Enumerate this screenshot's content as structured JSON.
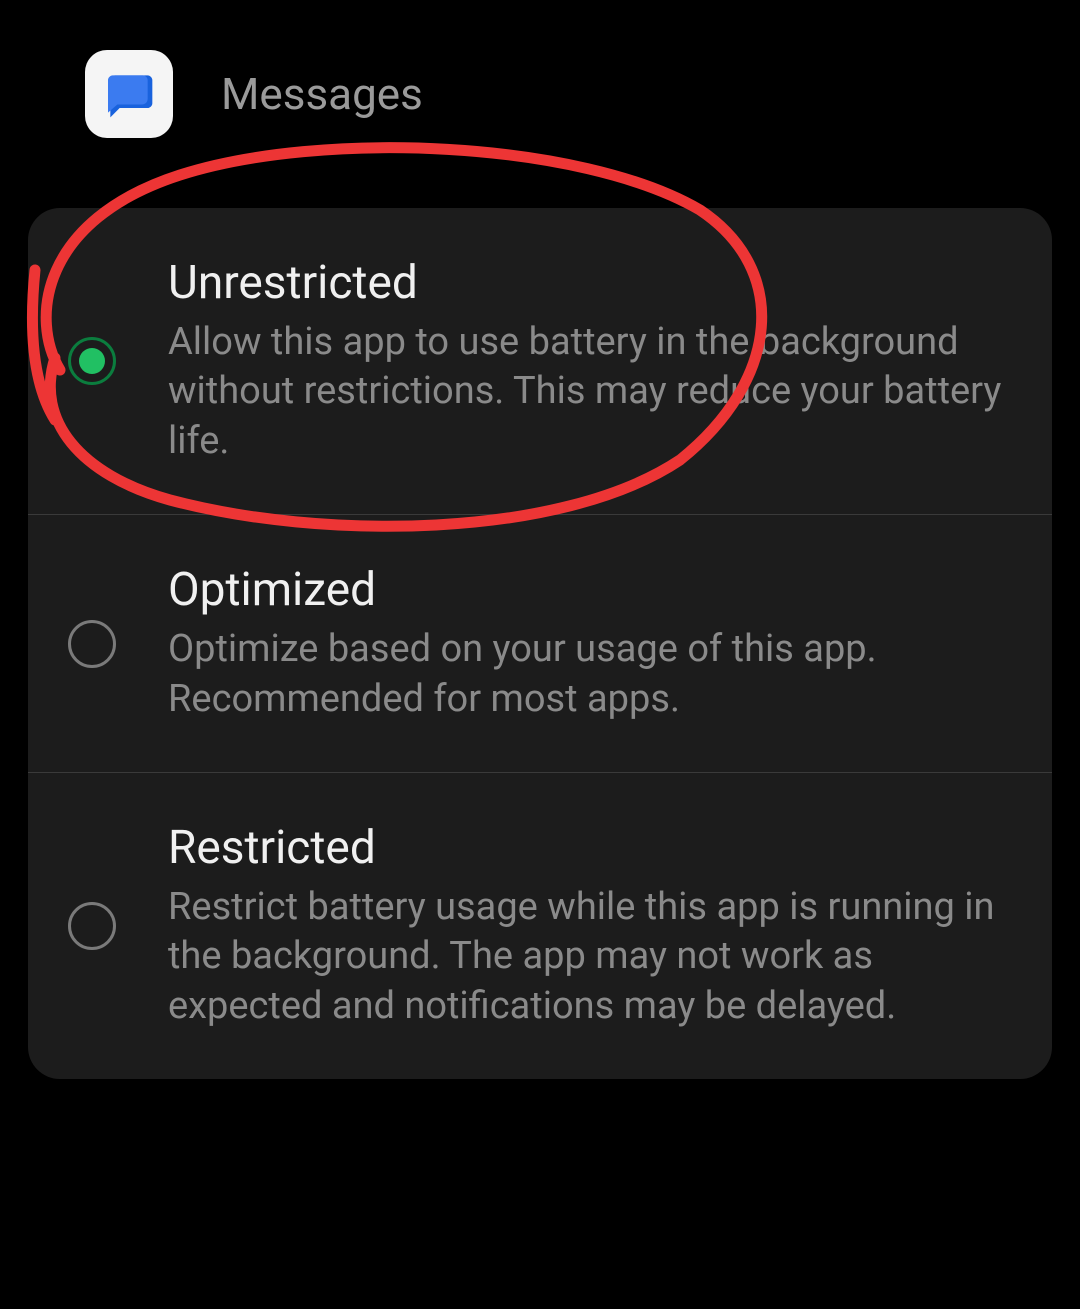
{
  "header": {
    "app_name": "Messages"
  },
  "options": [
    {
      "title": "Unrestricted",
      "description": "Allow this app to use battery in the background without restrictions. This may reduce your battery life.",
      "selected": true
    },
    {
      "title": "Optimized",
      "description": "Optimize based on your usage of this app. Recommended for most apps.",
      "selected": false
    },
    {
      "title": "Restricted",
      "description": "Restrict battery usage while this app is running in the background. The app may not work as expected and notifications may be delayed.",
      "selected": false
    }
  ],
  "annotation": {
    "color": "#ed3535"
  }
}
